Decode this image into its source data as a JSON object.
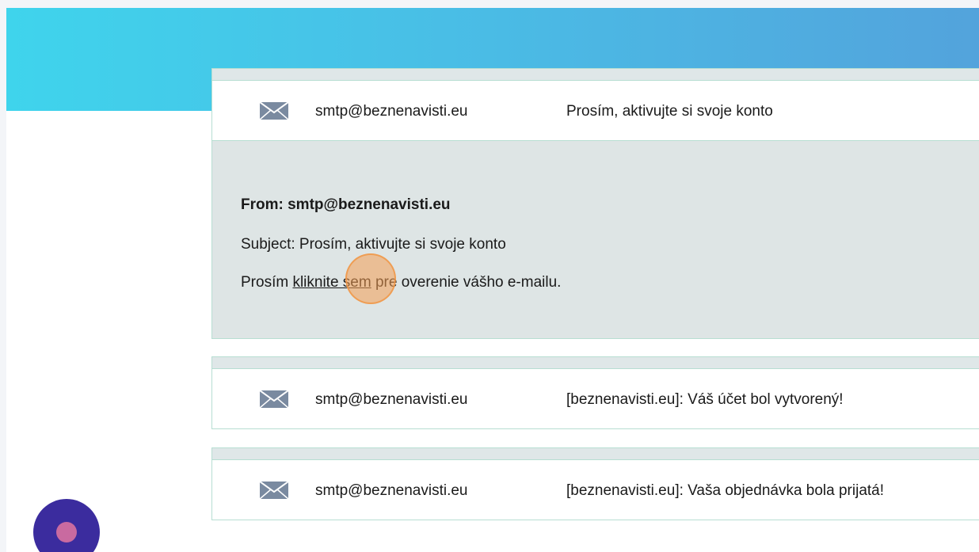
{
  "emails": [
    {
      "sender": "smtp@beznenavisti.eu",
      "subject": "Prosím, aktivujte si svoje konto",
      "expanded": true,
      "detail": {
        "from_line": "From: smtp@beznenavisti.eu",
        "subject_line": "Subject: Prosím, aktivujte si svoje konto",
        "body_prefix": "Prosím ",
        "body_link": "kliknite sem",
        "body_suffix": " pre overenie vášho e-mailu."
      }
    },
    {
      "sender": "smtp@beznenavisti.eu",
      "subject": "[beznenavisti.eu]: Váš účet bol vytvorený!",
      "expanded": false
    },
    {
      "sender": "smtp@beznenavisti.eu",
      "subject": "[beznenavisti.eu]: Vaša objednávka bola prijatá!",
      "expanded": false
    }
  ],
  "icons": {
    "envelope": "envelope-icon"
  },
  "colors": {
    "hero_gradient_start": "#3fd4ec",
    "hero_gradient_end": "#53a3dc",
    "card_border": "#b7ded2",
    "detail_background": "#dee5e5",
    "envelope": "#7a8aa0",
    "fab": "#3b2c9e",
    "fab_dot": "#c96aa0",
    "click_marker": "#f49e54"
  }
}
